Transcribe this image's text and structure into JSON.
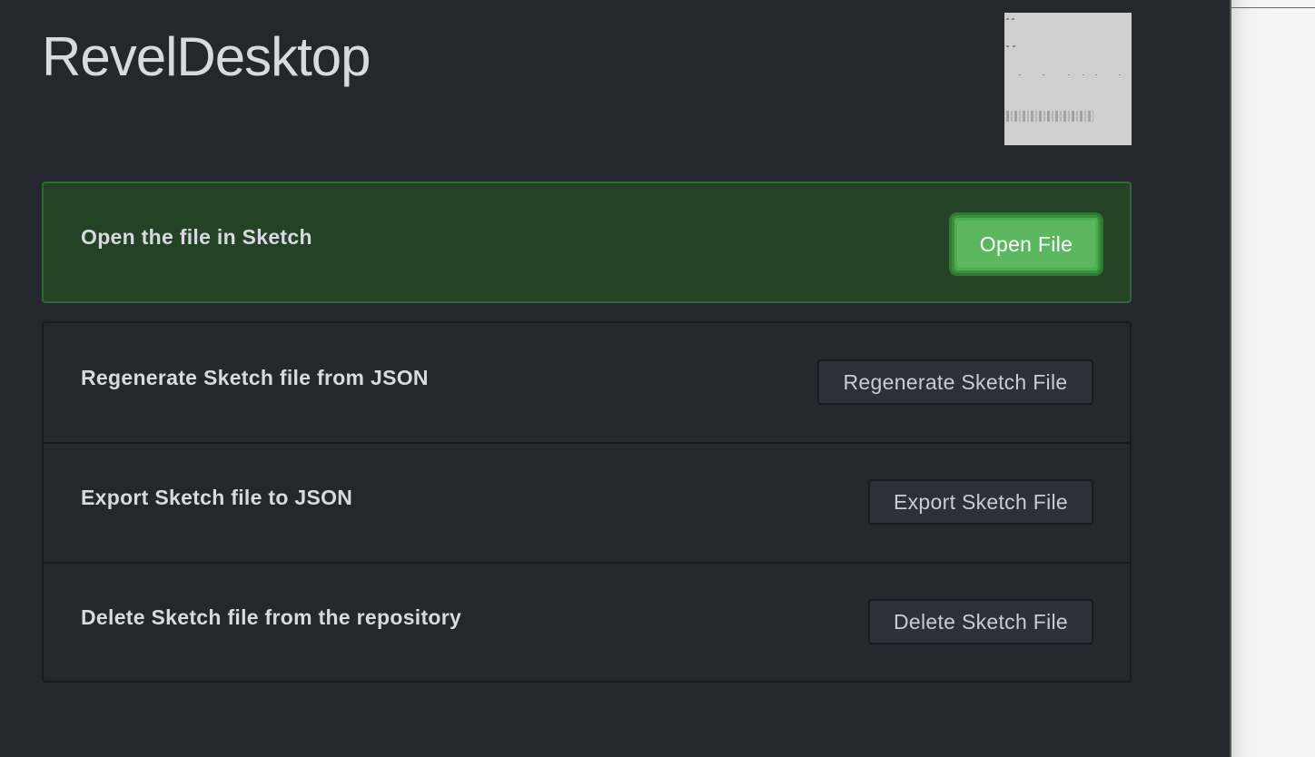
{
  "app": {
    "title": "RevelDesktop"
  },
  "thumbnail": {
    "icon": "sketch-file-preview"
  },
  "open_panel": {
    "label": "Open the file in Sketch",
    "button_label": "Open File"
  },
  "actions": [
    {
      "label": "Regenerate Sketch file from JSON",
      "button_label": "Regenerate Sketch File"
    },
    {
      "label": "Export Sketch file to JSON",
      "button_label": "Export Sketch File"
    },
    {
      "label": "Delete Sketch file from the repository",
      "button_label": "Delete Sketch File"
    }
  ],
  "colors": {
    "background": "#24272d",
    "primary_panel": "#244326",
    "primary_button": "#5cb85f",
    "text": "#d7dae0"
  }
}
